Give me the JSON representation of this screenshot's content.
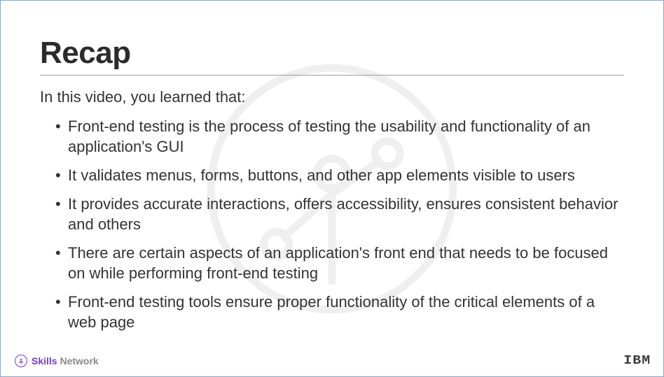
{
  "title": "Recap",
  "intro": "In this video, you learned that:",
  "bullets": [
    "Front-end testing is the process of testing the usability and functionality of an application's GUI",
    "It validates menus, forms, buttons, and other app elements visible to users",
    "It provides accurate interactions, offers accessibility, ensures consistent behavior and others",
    "There are certain aspects of an application's front end that needs to be focused on while performing front-end testing",
    "Front-end testing tools ensure proper functionality of the critical elements of a web page"
  ],
  "footer": {
    "skills_word": "Skills",
    "network_word": "Network",
    "ibm": "IBM"
  }
}
